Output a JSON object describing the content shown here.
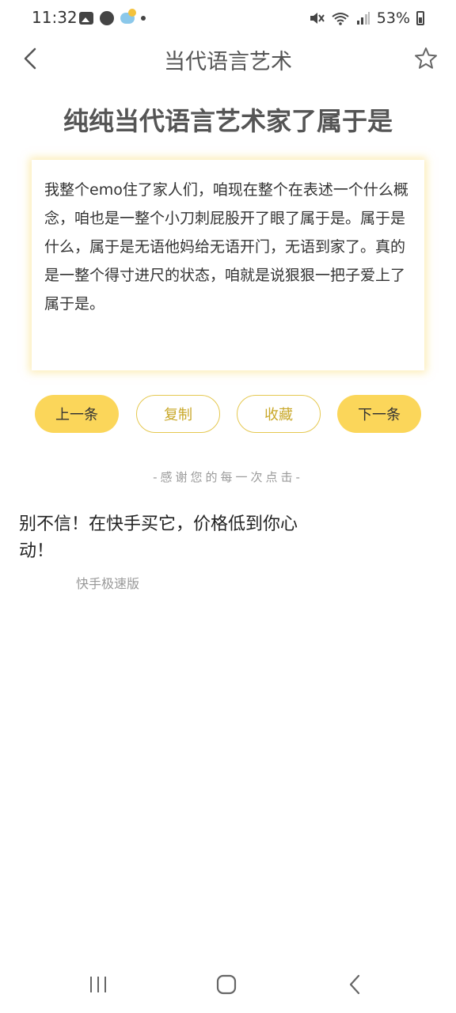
{
  "status_bar": {
    "time": "11:32",
    "battery": "53%",
    "icons": [
      "gallery-icon",
      "moon-icon",
      "weather-icon",
      "dot-icon",
      "mute-icon",
      "wifi-icon",
      "signal-icon",
      "battery-icon"
    ]
  },
  "header": {
    "title": "当代语言艺术",
    "back_icon": "chevron-left-icon",
    "favorite_icon": "star-outline-icon"
  },
  "article": {
    "headline": "纯纯当代语言艺术家了属于是",
    "body": "我整个emo住了家人们，咱现在整个在表述一个什么概念，咱也是一整个小刀刺屁股开了眼了属于是。属于是什么，属于是无语他妈给无语开门，无语到家了。真的是一整个得寸进尺的状态，咱就是说狠狠一把子爱上了属于是。"
  },
  "actions": {
    "prev_label": "上一条",
    "copy_label": "复制",
    "favorite_label": "收藏",
    "next_label": "下一条"
  },
  "thanks_text": "-感谢您的每一次点击-",
  "ad": {
    "text": "别不信！在快手买它，价格低到你心动！",
    "source": "快手极速版"
  },
  "colors": {
    "accent": "#fbd65a",
    "accent_border": "#e5c850",
    "accent_text": "#c9a82a"
  },
  "nav_bar": {
    "icons": [
      "recent-apps-icon",
      "home-icon",
      "back-icon"
    ]
  }
}
